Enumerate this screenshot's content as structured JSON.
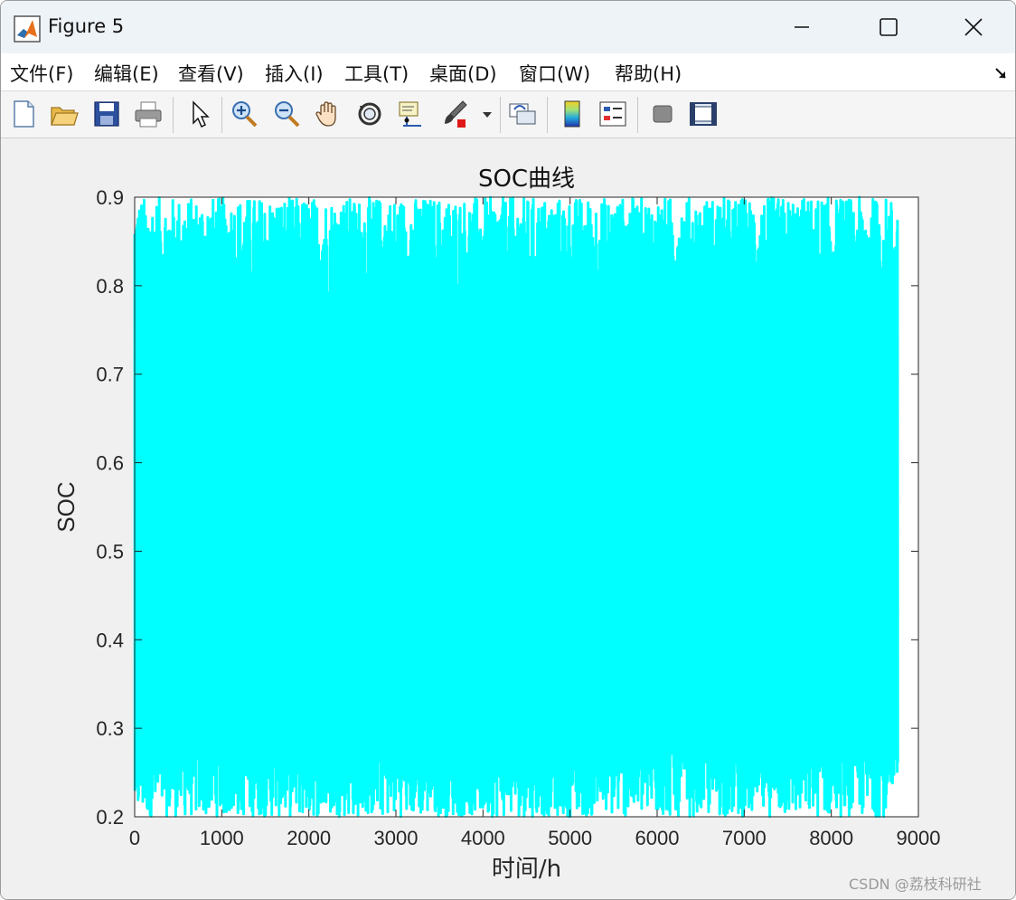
{
  "window": {
    "title": "Figure 5",
    "controls": {
      "minimize": "minimize-icon",
      "maximize": "maximize-icon",
      "close": "close-icon"
    }
  },
  "menubar": {
    "items": [
      {
        "label": "文件(F)"
      },
      {
        "label": "编辑(E)"
      },
      {
        "label": "查看(V)"
      },
      {
        "label": "插入(I)"
      },
      {
        "label": "工具(T)"
      },
      {
        "label": "桌面(D)"
      },
      {
        "label": "窗口(W)"
      },
      {
        "label": "帮助(H)"
      }
    ]
  },
  "toolbar": {
    "tools": [
      "new-figure-icon",
      "open-file-icon",
      "save-icon",
      "print-icon",
      "select-arrow-icon",
      "zoom-in-icon",
      "zoom-out-icon",
      "pan-hand-icon",
      "rotate-3d-icon",
      "data-cursor-icon",
      "brush-icon",
      "brush-dropdown-icon",
      "link-plot-icon",
      "colorbar-icon",
      "legend-icon",
      "hide-plot-tools-icon",
      "show-plot-tools-icon"
    ]
  },
  "chart_data": {
    "type": "line",
    "title": "SOC曲线",
    "xlabel": "时间/h",
    "ylabel": "SOC",
    "xlim": [
      0,
      9000
    ],
    "ylim": [
      0.2,
      0.9
    ],
    "xticks": [
      "0",
      "1000",
      "2000",
      "3000",
      "4000",
      "5000",
      "6000",
      "7000",
      "8000",
      "9000"
    ],
    "yticks": [
      "0.2",
      "0.3",
      "0.4",
      "0.5",
      "0.6",
      "0.7",
      "0.8",
      "0.9"
    ],
    "series": [
      {
        "color": "#00ffff",
        "x_range": [
          0,
          8760
        ],
        "soc_min": 0.2,
        "soc_max": 0.9,
        "pattern": "dense daily charge-discharge cycling, hourly resolution"
      }
    ],
    "grid": false
  },
  "watermark": "CSDN @荔枝科研社"
}
